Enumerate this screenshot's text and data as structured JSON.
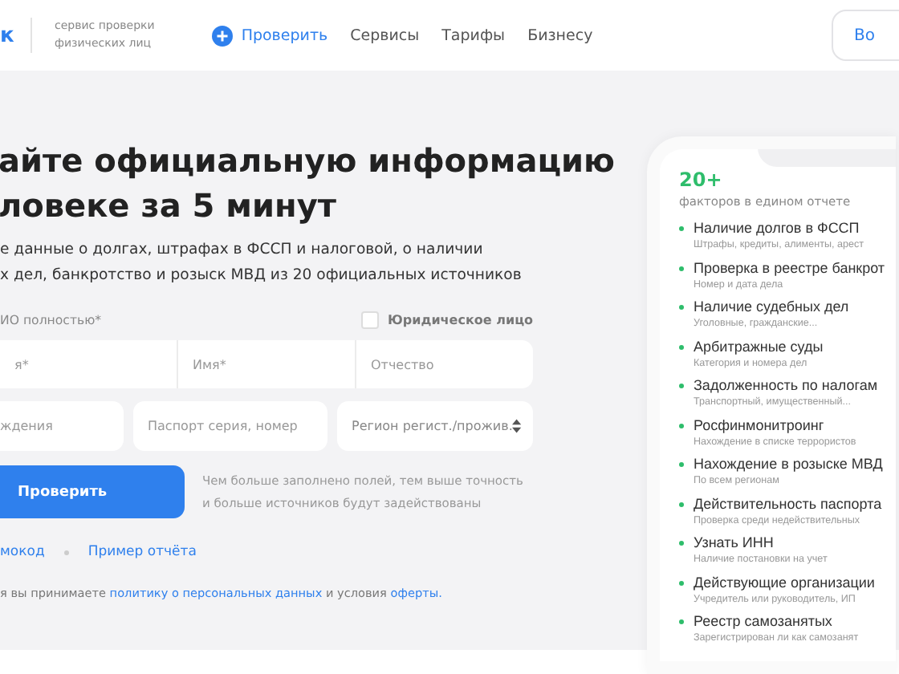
{
  "header": {
    "logo": "к",
    "tagline": [
      "сервис проверки",
      "физических лиц"
    ],
    "nav": [
      {
        "label": "Проверить",
        "selected": true
      },
      {
        "label": "Сервисы",
        "selected": false
      },
      {
        "label": "Тарифы",
        "selected": false
      },
      {
        "label": "Бизнесу",
        "selected": false
      }
    ],
    "login_button": "Во"
  },
  "hero": {
    "title": [
      "айте официальную информацию",
      "ловеке за 5 минут"
    ],
    "subtitle": [
      "е данные о долгах, штрафах в ФССП и налоговой, о наличии",
      "х дел, банкротство и розыск МВД из 20 официальных источников"
    ]
  },
  "form": {
    "fio_label": "ИО полностью*",
    "legal_entity": {
      "label": "Юридическое лицо",
      "checked": false
    },
    "name_fields": [
      {
        "placeholder": "я*"
      },
      {
        "placeholder": "Имя*"
      },
      {
        "placeholder": "Отчество"
      }
    ],
    "detail_fields": [
      {
        "placeholder": "ждения",
        "kind": "input"
      },
      {
        "placeholder": "Паспорт серия, номер",
        "kind": "input"
      },
      {
        "placeholder": "Регион регист./прожив.",
        "kind": "select"
      }
    ],
    "submit": "Проверить",
    "hint": [
      "Чем больше заполнено полей, тем выше точность",
      "и больше источников будут задействованы"
    ],
    "links": [
      "мокод",
      "Пример отчёта"
    ],
    "consent": [
      {
        "text": "я вы принимаете",
        "link": false
      },
      {
        "text": "политику о персональных данных",
        "link": true
      },
      {
        "text": "и условия",
        "link": false
      },
      {
        "text": "оферты.",
        "link": true
      }
    ]
  },
  "report": {
    "count": "20+",
    "caption": "факторов в едином отчете",
    "items": [
      {
        "title": "Наличие долгов в ФССП",
        "detail": "Штрафы, кредиты, алименты, арест"
      },
      {
        "title": "Проверка в реестре банкрот",
        "detail": "Номер и дата дела"
      },
      {
        "title": "Наличие судебных дел",
        "detail": "Уголовные, гражданские..."
      },
      {
        "title": "Арбитражные суды",
        "detail": "Категория и номера дел"
      },
      {
        "title": "Задолженность по налогам",
        "detail": "Транспортный, имущественный..."
      },
      {
        "title": "Росфинмонитроинг",
        "detail": "Нахождение в списке террористов"
      },
      {
        "title": "Нахождение в розыске МВД",
        "detail": "По всем регионам"
      },
      {
        "title": "Действительность паспорта",
        "detail": "Проверка среди недействительных"
      },
      {
        "title": "Узнать ИНН",
        "detail": "Наличие постановки на учет"
      },
      {
        "title": "Действующие организации",
        "detail": "Учредитель или руководитель, ИП"
      },
      {
        "title": "Реестр самозанятых",
        "detail": "Зарегистрирован ли как самозанят"
      }
    ]
  }
}
